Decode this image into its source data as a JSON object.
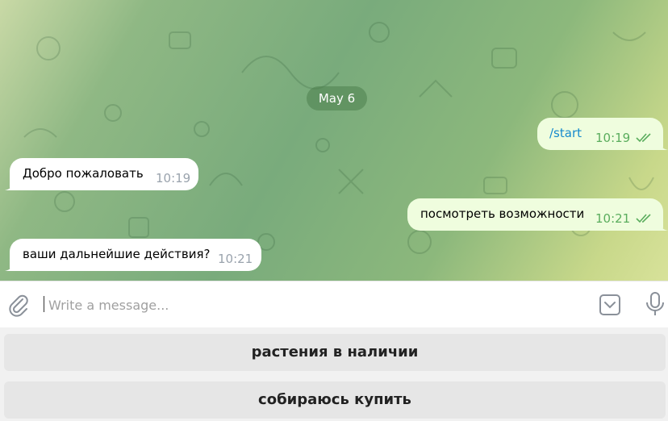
{
  "chat": {
    "date_label": "May 6",
    "messages": [
      {
        "direction": "out",
        "text": "/start",
        "time": "10:19",
        "status": "read"
      },
      {
        "direction": "in",
        "text": "Добро пожаловать",
        "time": "10:19"
      },
      {
        "direction": "out",
        "text": "посмотреть возможности",
        "time": "10:21",
        "status": "read"
      },
      {
        "direction": "in",
        "text": "ваши дальнейшие действия?",
        "time": "10:21"
      }
    ]
  },
  "composer": {
    "placeholder": "Write a message...",
    "value": ""
  },
  "keyboard": {
    "buttons": [
      "растения в наличии",
      "собираюсь купить"
    ]
  },
  "colors": {
    "outgoing_bubble": "#effdde",
    "incoming_bubble": "#ffffff",
    "link": "#168acd",
    "time_out": "#5aad5d",
    "time_in": "#9aa3ad"
  },
  "icons": [
    "paperclip-icon",
    "keyboard-toggle-icon",
    "microphone-icon",
    "double-check-icon"
  ]
}
